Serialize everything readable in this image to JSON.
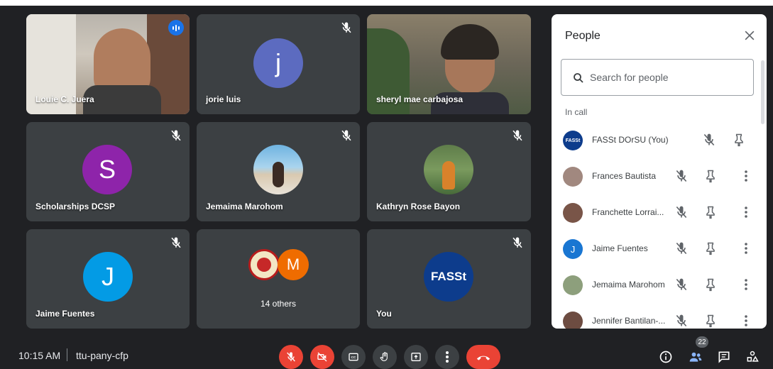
{
  "participants": [
    {
      "name": "Louie C. Juera",
      "type": "video"
    },
    {
      "name": "jorie luis",
      "initial": "j",
      "color": "#5c6bc0"
    },
    {
      "name": "sheryl mae carbajosa",
      "type": "video"
    },
    {
      "name": "Scholarships DCSP",
      "initial": "S",
      "color": "#8e24aa"
    },
    {
      "name": "Jemaima Marohom",
      "type": "photo"
    },
    {
      "name": "Kathryn Rose Bayon",
      "type": "photo"
    },
    {
      "name": "Jaime Fuentes",
      "initial": "J",
      "color": "#039be5"
    },
    {
      "name": "14 others",
      "initial": "M",
      "color": "#ef6c00"
    },
    {
      "name": "You",
      "logo_text": "FASSt"
    }
  ],
  "people_panel": {
    "title": "People",
    "search_placeholder": "Search for people",
    "section_label": "In call",
    "people": [
      {
        "name": "FASSt DOrSU (You)",
        "avatar_text": "FASSt",
        "avatar_color": "#0d3c8c"
      },
      {
        "name": "Frances Bautista",
        "avatar_color": "#a1887f"
      },
      {
        "name": "Franchette Lorrai...",
        "avatar_color": "#795548"
      },
      {
        "name": "Jaime Fuentes",
        "avatar_text": "J",
        "avatar_color": "#1976d2"
      },
      {
        "name": "Jemaima Marohom",
        "avatar_color": "#8d9f7c"
      },
      {
        "name": "Jennifer Bantilan-...",
        "avatar_color": "#6d4c41"
      }
    ]
  },
  "bottom_bar": {
    "time": "10:15 AM",
    "meeting_code": "ttu-pany-cfp",
    "participant_count": "22"
  },
  "colors": {
    "background": "#202124",
    "tile": "#3c4043",
    "accent": "#8ab4f8",
    "danger": "#ea4335"
  }
}
